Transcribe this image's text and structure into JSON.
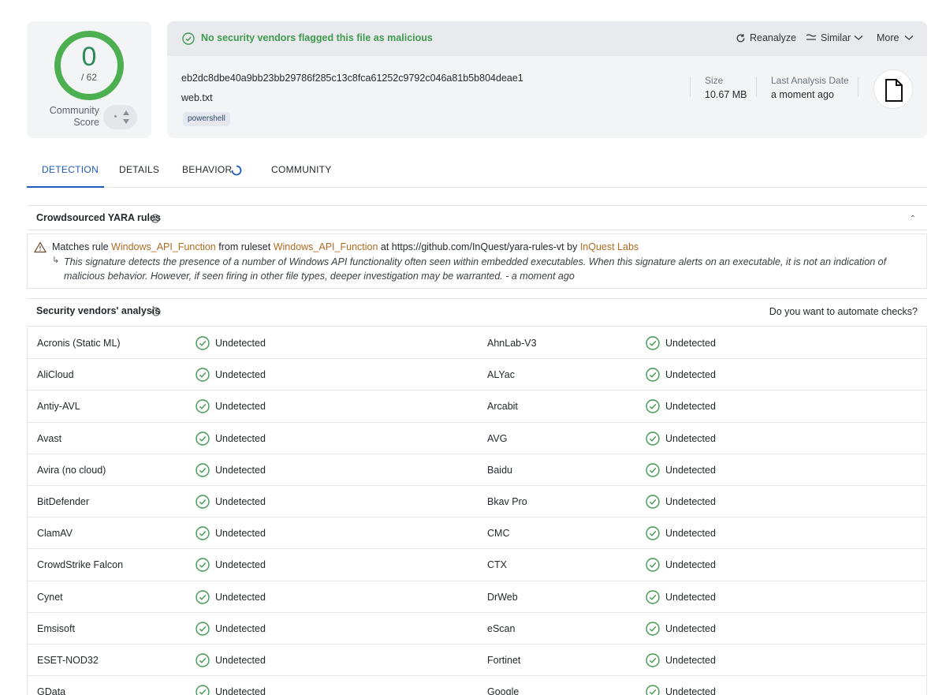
{
  "score": {
    "detections": "0",
    "total": "/ 62",
    "community_label": "Community Score",
    "accent": "#4caf50"
  },
  "summary": {
    "status": "No security vendors flagged this file as malicious",
    "actions": {
      "reanalyze": "Reanalyze",
      "similar": "Similar",
      "more": "More"
    },
    "hash": "eb2dc8dbe40a9bb23bb29786f285c13c8fca61252c9792c046a81b5b804deae1",
    "filename": "web.txt",
    "tag": "powershell",
    "size_label": "Size",
    "size_value": "10.67 MB",
    "date_label": "Last Analysis Date",
    "date_value": "a moment ago",
    "file_icon": "file-icon"
  },
  "tabs": [
    "DETECTION",
    "DETAILS",
    "BEHAVIOR",
    "COMMUNITY"
  ],
  "yara": {
    "title": "Crowdsourced YARA rules",
    "prefix": "Matches rule",
    "rule": "Windows_API_Function",
    "mid": "from ruleset",
    "ruleset": "Windows_API_Function",
    "at": "at https://github.com/InQuest/yara-rules-vt by",
    "author": "InQuest Labs",
    "description": "This signature detects the presence of a number of Windows API functionality often seen within embedded executables. When this signature alerts on an executable, it is not an indication of malicious behavior. However, if seen firing in other file types, deeper investigation may be warranted. - a moment ago"
  },
  "vendors": {
    "title": "Security vendors' analysis",
    "automate": "Do you want to automate checks?",
    "result_label": "Undetected",
    "rows": [
      [
        "Acronis (Static ML)",
        "AhnLab-V3"
      ],
      [
        "AliCloud",
        "ALYac"
      ],
      [
        "Antiy-AVL",
        "Arcabit"
      ],
      [
        "Avast",
        "AVG"
      ],
      [
        "Avira (no cloud)",
        "Baidu"
      ],
      [
        "BitDefender",
        "Bkav Pro"
      ],
      [
        "ClamAV",
        "CMC"
      ],
      [
        "CrowdStrike Falcon",
        "CTX"
      ],
      [
        "Cynet",
        "DrWeb"
      ],
      [
        "Emsisoft",
        "eScan"
      ],
      [
        "ESET-NOD32",
        "Fortinet"
      ],
      [
        "GData",
        "Google"
      ]
    ]
  }
}
